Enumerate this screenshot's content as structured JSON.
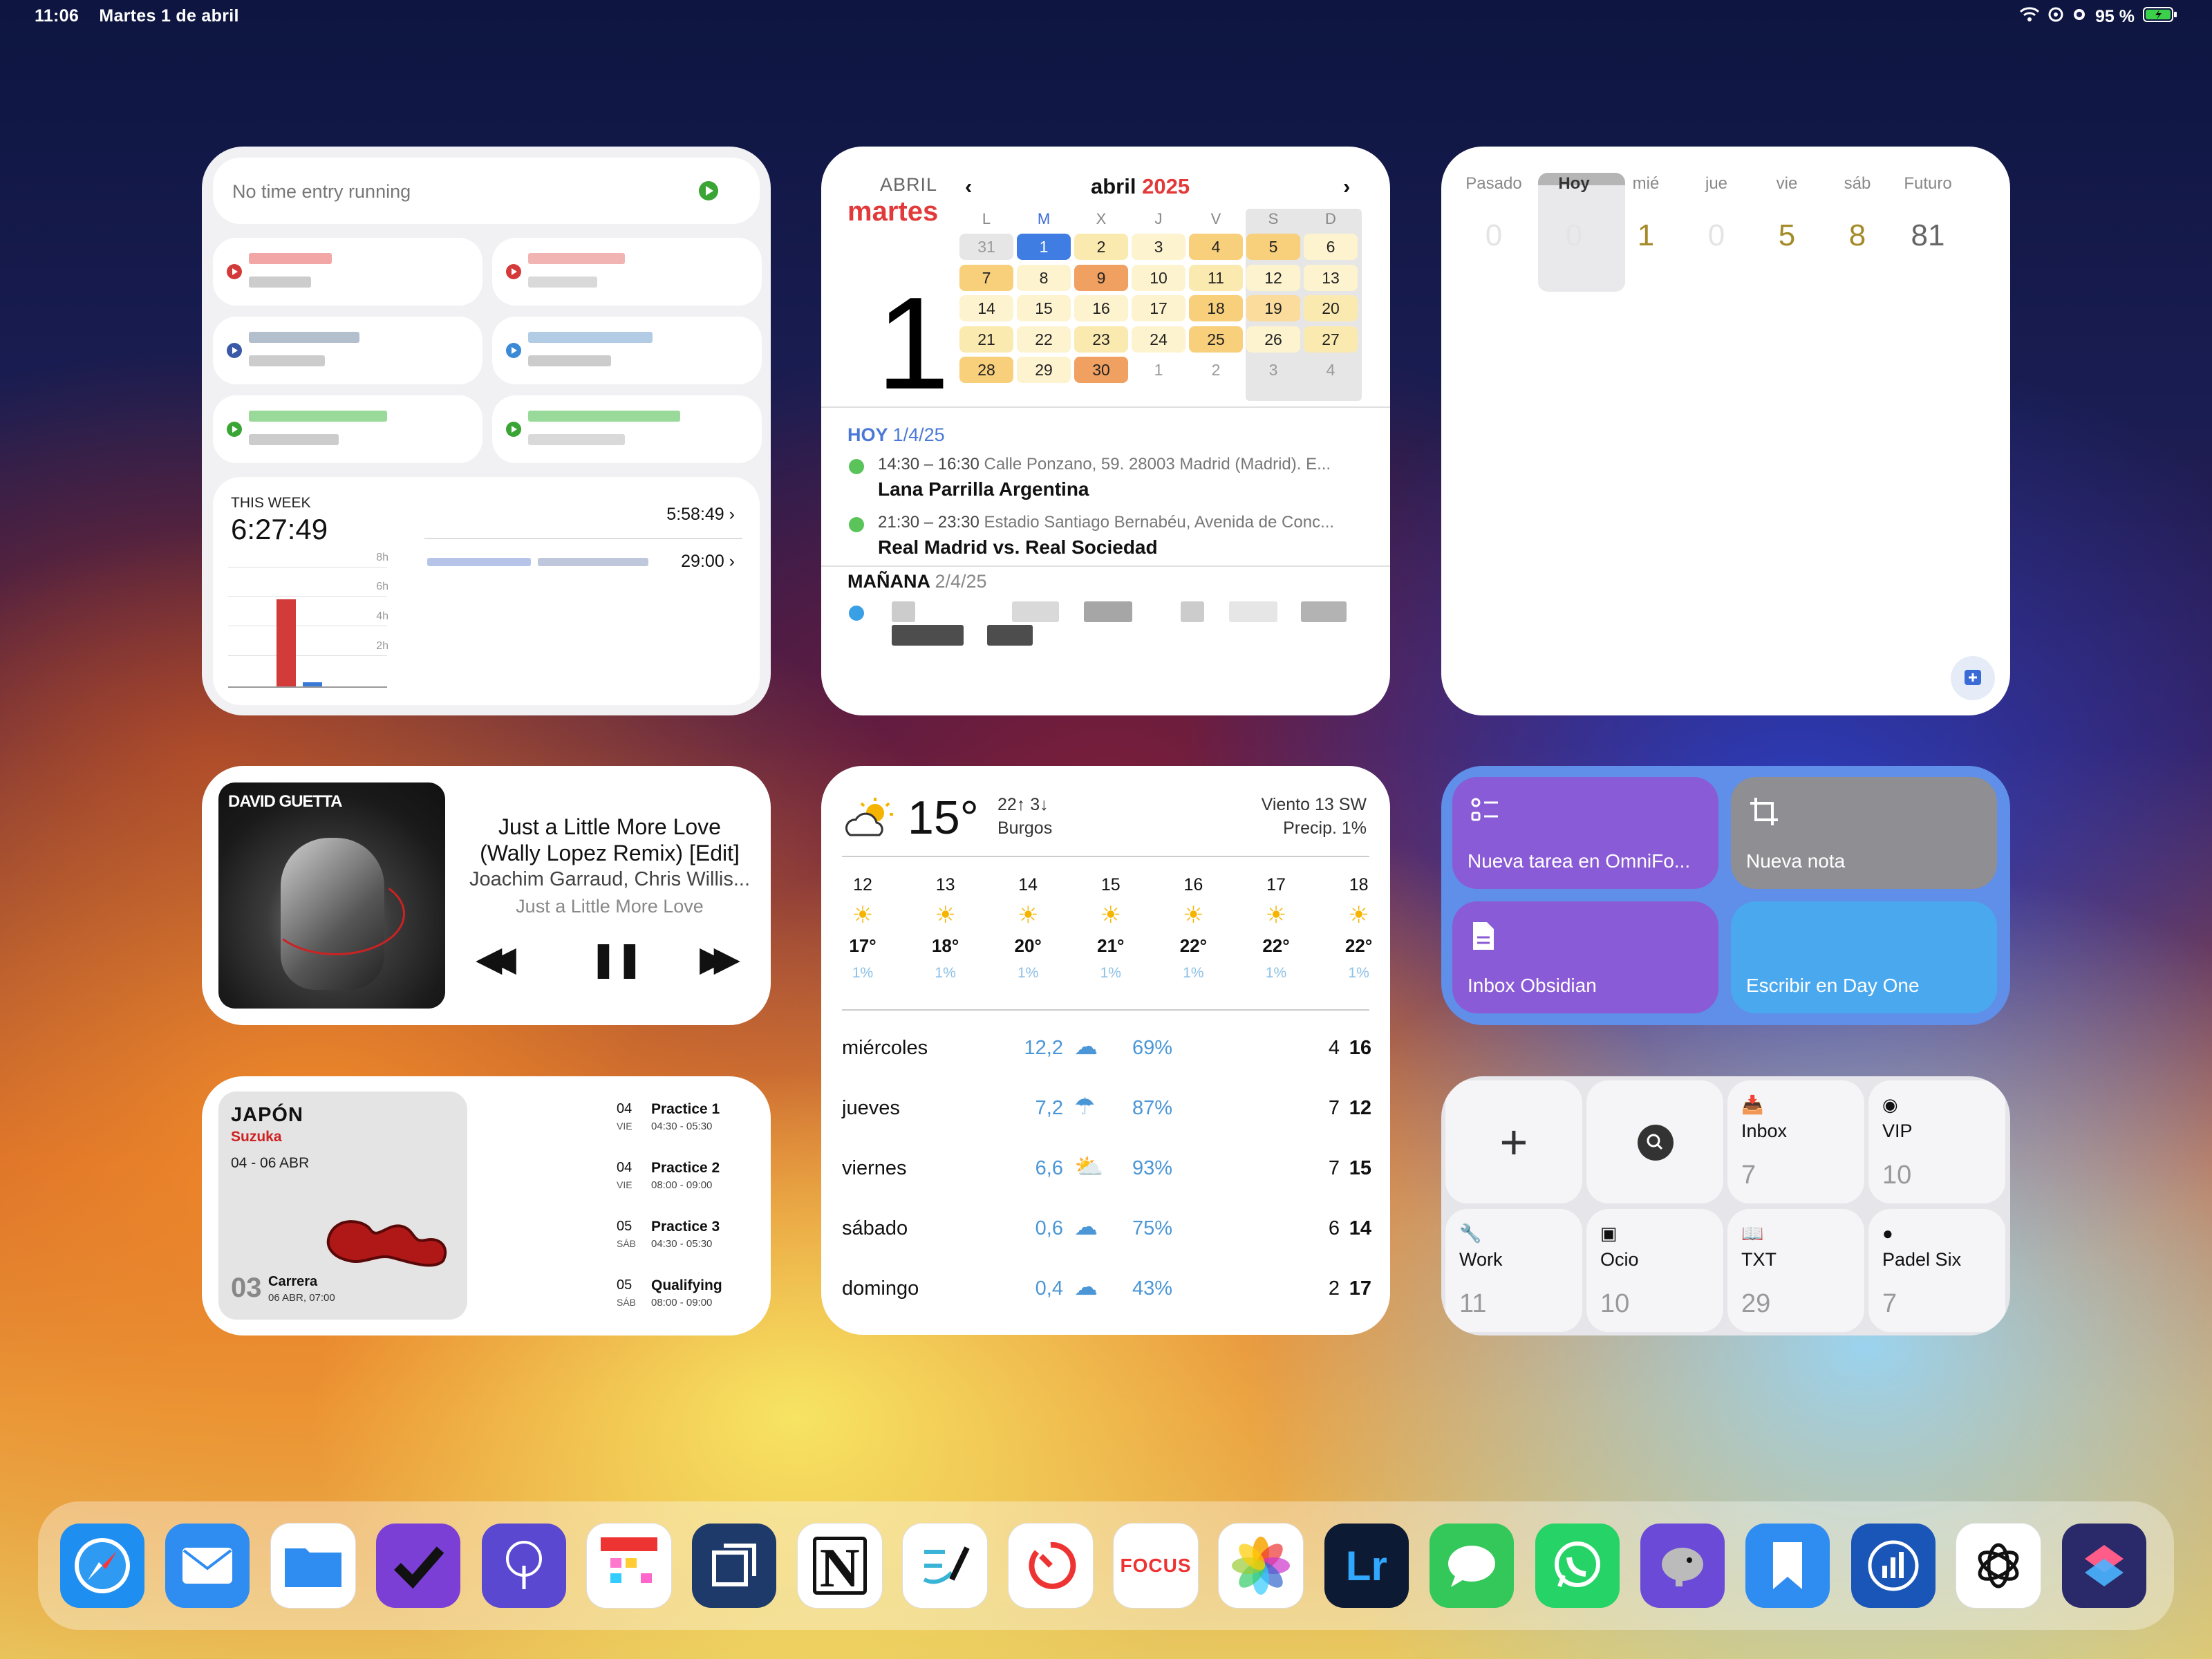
{
  "status_bar": {
    "time": "11:06",
    "date": "Martes 1 de abril",
    "battery": "95 %"
  },
  "timer": {
    "header": "No time entry running",
    "week_label": "THIS WEEK",
    "week_total": "6:27:49",
    "row1_time": "5:58:49",
    "row2_time": "29:00",
    "ticks": [
      "8h",
      "6h",
      "4h",
      "2h"
    ],
    "entry_colors": [
      "#d33a3a",
      "#d33a3a",
      "#3a5aa8",
      "#3a8ad6",
      "#3aa535",
      "#3aa535"
    ]
  },
  "calendar": {
    "month_small": "ABRIL",
    "weekday": "martes",
    "big_day": "1",
    "month_title": "abril",
    "year": "2025",
    "weekdays": [
      "L",
      "M",
      "X",
      "J",
      "V",
      "S",
      "D"
    ],
    "weeks": [
      [
        "31",
        "1",
        "2",
        "3",
        "4",
        "5",
        "6"
      ],
      [
        "7",
        "8",
        "9",
        "10",
        "11",
        "12",
        "13"
      ],
      [
        "14",
        "15",
        "16",
        "17",
        "18",
        "19",
        "20"
      ],
      [
        "21",
        "22",
        "23",
        "24",
        "25",
        "26",
        "27"
      ],
      [
        "28",
        "29",
        "30",
        "1",
        "2",
        "3",
        "4"
      ]
    ],
    "today_label": "HOY",
    "today_date": "1/4/25",
    "events": [
      {
        "time": "14:30 – 16:30",
        "location": "Calle Ponzano, 59. 28003 Madrid (Madrid). E...",
        "title": "Lana Parrilla Argentina"
      },
      {
        "time": "21:30 – 23:30",
        "location": "Estadio Santiago Bernabéu, Avenida de Conc...",
        "title": "Real Madrid vs. Real Sociedad"
      }
    ],
    "tomorrow_label": "MAÑANA",
    "tomorrow_date": "2/4/25"
  },
  "counts": {
    "columns": [
      {
        "label": "Pasado",
        "value": "0"
      },
      {
        "label": "Hoy",
        "value": "0"
      },
      {
        "label": "mié",
        "value": "1"
      },
      {
        "label": "jue",
        "value": "0"
      },
      {
        "label": "vie",
        "value": "5"
      },
      {
        "label": "sáb",
        "value": "8"
      },
      {
        "label": "Futuro",
        "value": "81"
      }
    ]
  },
  "music": {
    "title_line1": "Just a Little More Love",
    "title_line2": "(Wally Lopez Remix) [Edit]",
    "artist": "Joachim Garraud, Chris Willis...",
    "album": "Just a Little More Love",
    "cover_text": "DAVID GUETTA",
    "prev": "◀◀",
    "pause": "❚❚",
    "next": "▶▶"
  },
  "f1": {
    "country": "JAPÓN",
    "city": "Suzuka",
    "dates": "04 - 06 ABR",
    "round": "03",
    "race": "Carrera",
    "race_time": "06 ABR, 07:00",
    "sessions": [
      {
        "day": "04",
        "wday": "VIE",
        "name": "Practice 1",
        "time": "04:30 - 05:30"
      },
      {
        "day": "04",
        "wday": "VIE",
        "name": "Practice 2",
        "time": "08:00 - 09:00"
      },
      {
        "day": "05",
        "wday": "SÁB",
        "name": "Practice 3",
        "time": "04:30 - 05:30"
      },
      {
        "day": "05",
        "wday": "SÁB",
        "name": "Qualifying",
        "time": "08:00 - 09:00"
      }
    ]
  },
  "weather": {
    "temp": "15°",
    "high_low": "22↑ 3↓",
    "city": "Burgos",
    "wind": "Viento 13 SW",
    "precip": "Precip. 1%",
    "hours": [
      {
        "h": "12",
        "t": "17°",
        "p": "1%"
      },
      {
        "h": "13",
        "t": "18°",
        "p": "1%"
      },
      {
        "h": "14",
        "t": "20°",
        "p": "1%"
      },
      {
        "h": "15",
        "t": "21°",
        "p": "1%"
      },
      {
        "h": "16",
        "t": "22°",
        "p": "1%"
      },
      {
        "h": "17",
        "t": "22°",
        "p": "1%"
      },
      {
        "h": "18",
        "t": "22°",
        "p": "1%"
      }
    ],
    "days": [
      {
        "name": "miércoles",
        "mm": "12,2",
        "pct": "69%",
        "lo": "4",
        "hi": "16"
      },
      {
        "name": "jueves",
        "mm": "7,2",
        "pct": "87%",
        "lo": "7",
        "hi": "12"
      },
      {
        "name": "viernes",
        "mm": "6,6",
        "pct": "93%",
        "lo": "7",
        "hi": "15"
      },
      {
        "name": "sábado",
        "mm": "0,6",
        "pct": "75%",
        "lo": "6",
        "hi": "14"
      },
      {
        "name": "domingo",
        "mm": "0,4",
        "pct": "43%",
        "lo": "2",
        "hi": "17"
      }
    ]
  },
  "shortcuts": [
    {
      "label": "Nueva tarea en OmniFo...",
      "color": "#8a5bd6"
    },
    {
      "label": "Nueva nota",
      "color": "#8e8e93"
    },
    {
      "label": "Inbox Obsidian",
      "color": "#8a5bd6"
    },
    {
      "label": "Escribir en Day One",
      "color": "#4aa8ee"
    }
  ],
  "mail": {
    "boxes": [
      {
        "label": "Inbox",
        "count": "7"
      },
      {
        "label": "VIP",
        "count": "10"
      },
      {
        "label": "Work",
        "count": "11"
      },
      {
        "label": "Ocio",
        "count": "10"
      },
      {
        "label": "TXT",
        "count": "29"
      },
      {
        "label": "Padel Six",
        "count": "7"
      }
    ]
  },
  "dock": {
    "focus_label": "FOCUS",
    "lr_label": "Lr",
    "notion_label": "N",
    "apps": [
      {
        "name": "safari",
        "color": "#1e8ef0"
      },
      {
        "name": "mail",
        "color": "#2f8cf0"
      },
      {
        "name": "files",
        "color": "#ffffff"
      },
      {
        "name": "omnifocus",
        "color": "#7b3fd6"
      },
      {
        "name": "tree-app",
        "color": "#5a48d0"
      },
      {
        "name": "fantastical",
        "color": "#ffffff"
      },
      {
        "name": "frame-app",
        "color": "#1d3a6a"
      },
      {
        "name": "notion",
        "color": "#ffffff"
      },
      {
        "name": "freeform",
        "color": "#ffffff"
      },
      {
        "name": "timer-app",
        "color": "#ffffff"
      },
      {
        "name": "focus",
        "color": "#ffffff"
      },
      {
        "name": "photos",
        "color": "#ffffff"
      },
      {
        "name": "lightroom",
        "color": "#0d1a33"
      },
      {
        "name": "messages",
        "color": "#34c759"
      },
      {
        "name": "whatsapp",
        "color": "#25d366"
      },
      {
        "name": "mastodon-app",
        "color": "#6a4ad6"
      },
      {
        "name": "bookmarks-app",
        "color": "#2f8cf0"
      },
      {
        "name": "stats-app",
        "color": "#1a56b8"
      },
      {
        "name": "chatgpt",
        "color": "#ffffff"
      },
      {
        "name": "shortcuts",
        "color": "#2a2a6a"
      }
    ]
  }
}
